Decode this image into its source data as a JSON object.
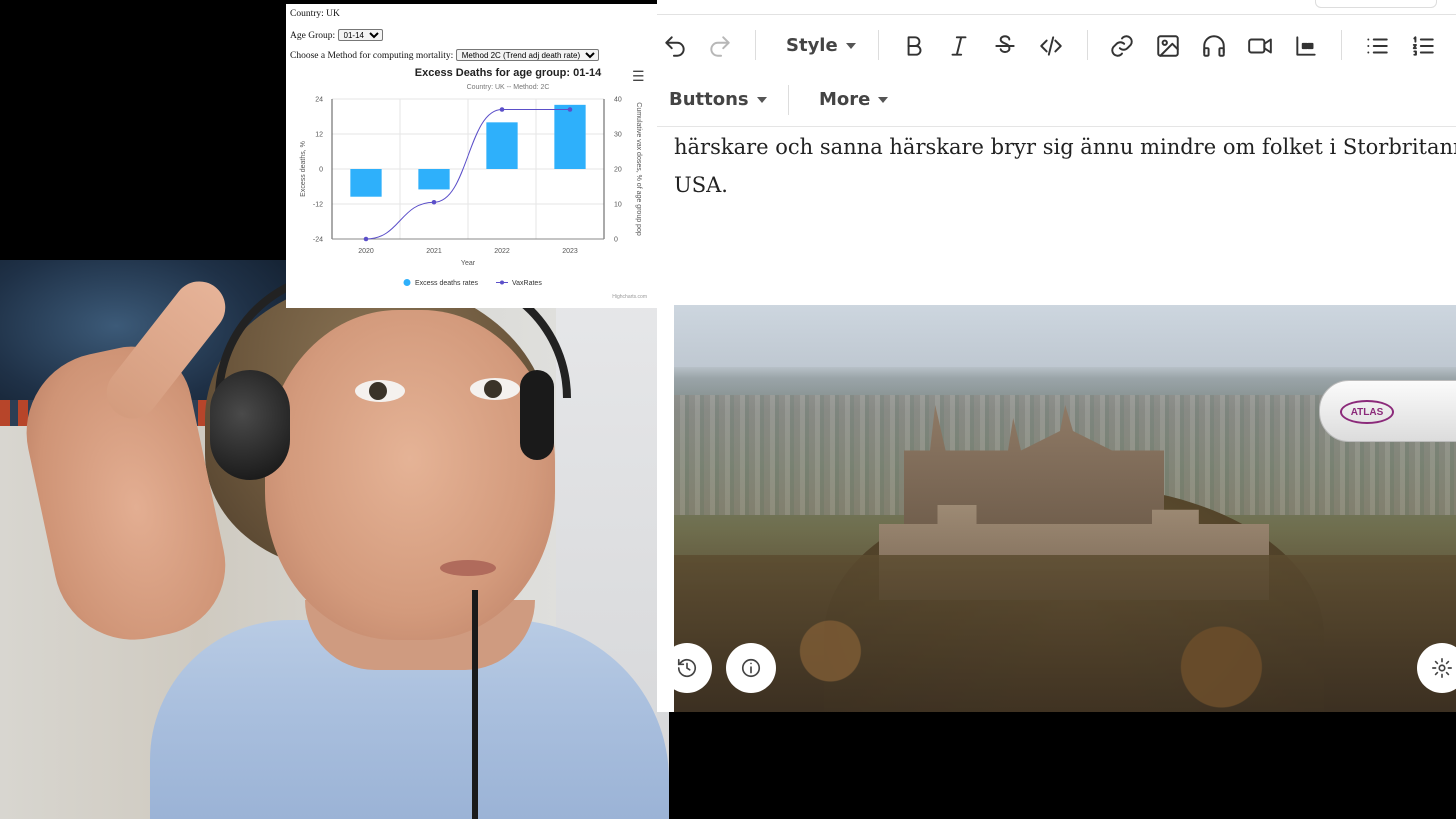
{
  "chart_panel": {
    "country_line": "Country: UK",
    "age_group_label": "Age Group:",
    "age_group_value": "01-14",
    "method_label": "Choose a Method for computing mortality:",
    "method_value": "Method 2C (Trend adj death rate)",
    "menu_icon": "hamburger-icon",
    "watermark": "Highcharts.com"
  },
  "chart_data": {
    "type": "bar",
    "title": "Excess Deaths for age group: 01-14",
    "subtitle": "Country: UK -- Method: 2C",
    "xlabel": "Year",
    "ylabel": "Excess deaths, %",
    "y2label": "Cumulative vax doses, % of age group pop",
    "categories": [
      "2020",
      "2021",
      "2022",
      "2023"
    ],
    "ylim": [
      -24,
      24
    ],
    "yticks": [
      "24",
      "12",
      "0",
      "-12",
      "-24"
    ],
    "y2lim": [
      0,
      40
    ],
    "y2ticks": [
      "40",
      "30",
      "20",
      "10",
      "0"
    ],
    "grid": true,
    "legend_position": "bottom-center",
    "series": [
      {
        "name": "Excess deaths rates",
        "type": "bar",
        "color": "#2eb0fb",
        "values": [
          -9.5,
          -7,
          16,
          22
        ]
      },
      {
        "name": "VaxRates",
        "type": "line",
        "color": "#5b4fc9",
        "axis": "right",
        "values": [
          0,
          10.5,
          37,
          37
        ]
      }
    ]
  },
  "toolbar": {
    "style_label": "Style",
    "buttons_label": "Buttons",
    "more_label": "More",
    "icons": [
      "undo-icon",
      "redo-icon",
      "bold-icon",
      "italic-icon",
      "strikethrough-icon",
      "code-icon",
      "link-icon",
      "image-icon",
      "audio-icon",
      "video-icon",
      "quote-icon",
      "bullet-list-icon",
      "numbered-list-icon"
    ]
  },
  "editor": {
    "line1": "härskare och sanna härskare bryr sig ännu mindre om folket i Storbritannien",
    "line2": "USA.",
    "blimp_logo_text": "ATLAS",
    "image_buttons": [
      "history-icon",
      "info-icon",
      "settings-icon"
    ]
  },
  "colors": {
    "bar": "#2eb0fb",
    "vax_line": "#5b4fc9",
    "toolbar_icon": "#333333"
  }
}
